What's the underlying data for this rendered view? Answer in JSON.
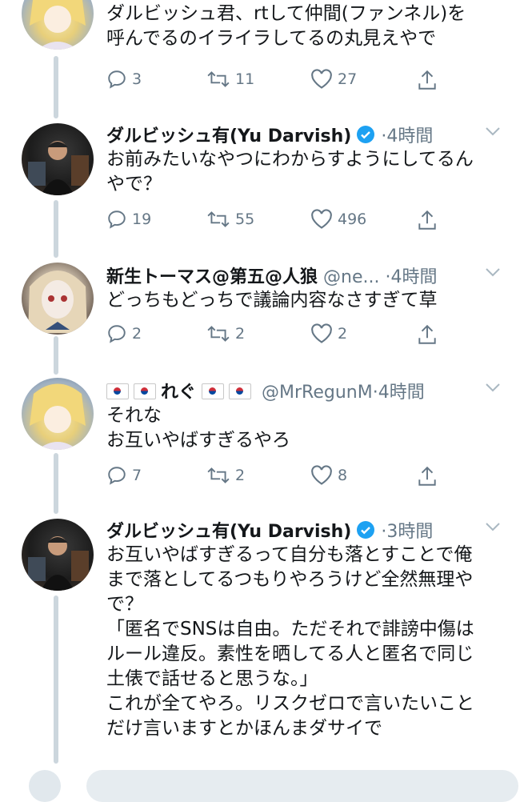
{
  "tweets": [
    {
      "avatar": "anime-blonde-girl",
      "name": "",
      "handle": "",
      "time": "",
      "text": "ダルビッシュ君、rtして仲間(ファンネル)を\n呼んでるのイライラしてるの丸見えやで",
      "replies": "3",
      "retweets": "11",
      "likes": "27"
    },
    {
      "avatar": "man-with-cap",
      "name": "ダルビッシュ有(Yu Darvish)",
      "verified": true,
      "handle": "",
      "time": "4時間",
      "text": "お前みたいなやつにわからすようにしてるん\nやで？",
      "replies": "19",
      "retweets": "55",
      "likes": "496"
    },
    {
      "avatar": "doll-girl",
      "name": "新生トーマス@第五@人狼",
      "handle": "@ne...",
      "time": "4時間",
      "text": "どっちもどっちで議論内容なさすぎて草",
      "replies": "2",
      "retweets": "2",
      "likes": "2"
    },
    {
      "avatar": "anime-blonde-girl",
      "name": "れぐ",
      "flags": "korea-flag",
      "handle": "@MrRegunM",
      "time": "4時間",
      "text": "それな\nお互いやばすぎるやろ",
      "replies": "7",
      "retweets": "2",
      "likes": "8"
    },
    {
      "avatar": "man-with-cap",
      "name": "ダルビッシュ有(Yu Darvish)",
      "verified": true,
      "handle": "",
      "time": "3時間",
      "text": "お互いやばすぎるって自分も落とすことで俺\nまで落としてるつもりやろうけど全然無理や\nで？\n「匿名でSNSは自由。ただそれで誹謗中傷は\nルール違反。素性を晒してる人と匿名で同じ\n土俵で話せると思うな。」\nこれが全てやろ。リスクゼロで言いたいこと\nだけ言いますとかほんまダサイで"
    }
  ],
  "colors": {
    "text": "#14171a",
    "secondary": "#657786",
    "verified": "#1da1f2",
    "thread_line": "#ccd6dd"
  },
  "separator": "·"
}
